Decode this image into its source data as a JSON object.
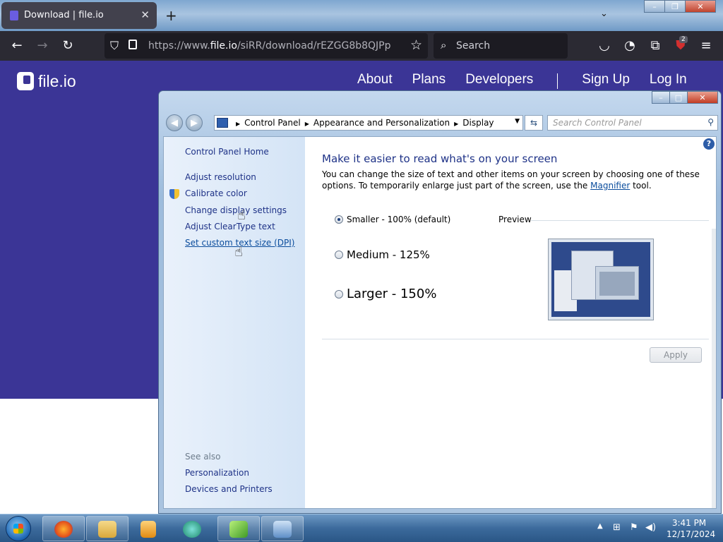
{
  "browser": {
    "tab_title": "Download | file.io",
    "tab_close": "✕",
    "new_tab": "+",
    "tabs_menu": "⌄",
    "url_prefix": "https://www.",
    "url_host": "file.io",
    "url_path": "/siRR/download/rEZGG8b8QJPp",
    "search_placeholder": "Search",
    "extension_badge": "2"
  },
  "site": {
    "logo_text": "file.io",
    "nav": [
      "About",
      "Plans",
      "Developers",
      "Sign Up",
      "Log In"
    ]
  },
  "control_panel": {
    "breadcrumbs": [
      "Control Panel",
      "Appearance and Personalization",
      "Display"
    ],
    "search_placeholder": "Search Control Panel",
    "left_links": {
      "home": "Control Panel Home",
      "adjust_resolution": "Adjust resolution",
      "calibrate_color": "Calibrate color",
      "change_display_settings": "Change display settings",
      "adjust_cleartype": "Adjust ClearType text",
      "custom_dpi": "Set custom text size (DPI)"
    },
    "see_also": {
      "title": "See also",
      "personalization": "Personalization",
      "devices_printers": "Devices and Printers"
    },
    "heading": "Make it easier to read what's on your screen",
    "description_before": "You can change the size of text and other items on your screen by choosing one of these options. To temporarily enlarge just part of the screen, use the ",
    "description_link": "Magnifier",
    "description_after": " tool.",
    "options": {
      "smaller": "Smaller - 100% (default)",
      "medium": "Medium - 125%",
      "larger": "Larger - 150%"
    },
    "selected_option": "smaller",
    "preview_label": "Preview",
    "apply_label": "Apply",
    "help_label": "?"
  },
  "taskbar": {
    "time": "3:41 PM",
    "date": "12/17/2024"
  }
}
